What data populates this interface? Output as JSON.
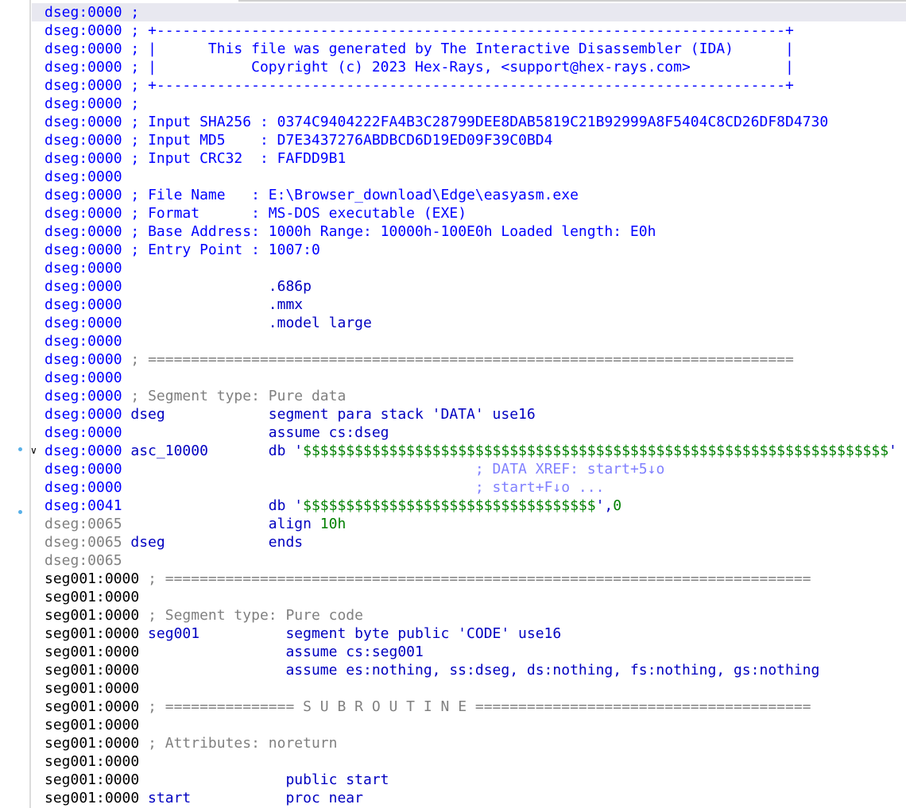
{
  "lines": [
    {
      "addr": "dseg:0000",
      "text": " ;"
    },
    {
      "addr": "dseg:0000",
      "text": " ; +-------------------------------------------------------------------------+"
    },
    {
      "addr": "dseg:0000",
      "text": " ; |      This file was generated by The Interactive Disassembler (IDA)      |"
    },
    {
      "addr": "dseg:0000",
      "text": " ; |           Copyright (c) 2023 Hex-Rays, <support@hex-rays.com>           |"
    },
    {
      "addr": "dseg:0000",
      "text": " ; +-------------------------------------------------------------------------+"
    },
    {
      "addr": "dseg:0000",
      "text": " ;"
    },
    {
      "addr": "dseg:0000",
      "text": " ; Input SHA256 : 0374C9404222FA4B3C28799DEE8DAB5819C21B92999A8F5404C8CD26DF8D4730"
    },
    {
      "addr": "dseg:0000",
      "text": " ; Input MD5    : D7E3437276ABDBCD6D19ED09F39C0BD4"
    },
    {
      "addr": "dseg:0000",
      "text": " ; Input CRC32  : FAFDD9B1"
    },
    {
      "addr": "dseg:0000",
      "text": ""
    },
    {
      "addr": "dseg:0000",
      "text": " ; File Name   : E:\\Browser_download\\Edge\\easyasm.exe"
    },
    {
      "addr": "dseg:0000",
      "text": " ; Format      : MS-DOS executable (EXE)"
    },
    {
      "addr": "dseg:0000",
      "text": " ; Base Address: 1000h Range: 10000h-100E0h Loaded length: E0h"
    },
    {
      "addr": "dseg:0000",
      "text": " ; Entry Point : 1007:0"
    },
    {
      "addr": "dseg:0000",
      "text": ""
    },
    {
      "addr": "dseg:0000",
      "text": "                 .686p"
    },
    {
      "addr": "dseg:0000",
      "text": "                 .mmx"
    },
    {
      "addr": "dseg:0000",
      "text": "                 .model large"
    },
    {
      "addr": "dseg:0000",
      "text": ""
    },
    {
      "addr": "dseg:0000",
      "text": " ; ==========================================================================="
    },
    {
      "addr": "dseg:0000",
      "text": ""
    },
    {
      "addr": "dseg:0000",
      "text": " ; Segment type: Pure data"
    },
    {
      "addr": "dseg:0000",
      "text": " dseg            segment para stack 'DATA' use16"
    },
    {
      "addr": "dseg:0000",
      "text": "                 assume cs:dseg"
    },
    {
      "addr": "dseg:0000",
      "text": " asc_10000       db '$$$$$$$$$$$$$$$$$$$$$$$$$$$$$$$$$$$$$$$$$$$$$$$$$$$$$$$$$$$$$$$$$$$$'"
    },
    {
      "addr": "dseg:0000",
      "text": "                                         ; DATA XREF: start+5↓o"
    },
    {
      "addr": "dseg:0000",
      "text": "                                         ; start+F↓o ..."
    },
    {
      "addr": "dseg:0041",
      "text": "                 db '$$$$$$$$$$$$$$$$$$$$$$$$$$$$$$$$$$',0"
    },
    {
      "addr": "dseg:0065",
      "text": "                 align 10h"
    },
    {
      "addr": "dseg:0065",
      "text": " dseg            ends"
    },
    {
      "addr": "dseg:0065",
      "text": ""
    },
    {
      "addr": "seg001:0000",
      "text": " ; ==========================================================================="
    },
    {
      "addr": "seg001:0000",
      "text": ""
    },
    {
      "addr": "seg001:0000",
      "text": " ; Segment type: Pure code"
    },
    {
      "addr": "seg001:0000",
      "text": " seg001          segment byte public 'CODE' use16"
    },
    {
      "addr": "seg001:0000",
      "text": "                 assume cs:seg001"
    },
    {
      "addr": "seg001:0000",
      "text": "                 assume es:nothing, ss:dseg, ds:nothing, fs:nothing, gs:nothing"
    },
    {
      "addr": "seg001:0000",
      "text": ""
    },
    {
      "addr": "seg001:0000",
      "text": " ; =============== S U B R O U T I N E ======================================="
    },
    {
      "addr": "seg001:0000",
      "text": ""
    },
    {
      "addr": "seg001:0000",
      "text": " ; Attributes: noreturn"
    },
    {
      "addr": "seg001:0000",
      "text": ""
    },
    {
      "addr": "seg001:0000",
      "text": "                 public start"
    },
    {
      "addr": "seg001:0000",
      "text": " start           proc near"
    }
  ],
  "gutter": {
    "collapse_icon": "chevron-down-icon",
    "marker_icon": "dot-icon"
  },
  "colors": {
    "dseg_address": "#0000ff",
    "dseg_address_inactive": "#808080",
    "seg001_address": "#000000",
    "comment": "#808080",
    "string_literal": "#008000",
    "xref_comment": "#8080ff",
    "instruction": "#0000c0",
    "current_line_highlight": "#e8e8f0"
  }
}
